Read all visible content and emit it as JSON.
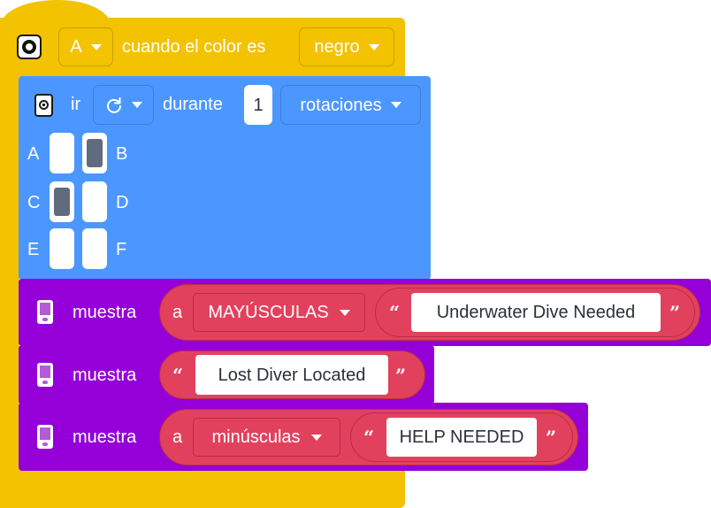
{
  "hat": {
    "port": "A",
    "label": "cuando el color es",
    "color": "negro"
  },
  "motor": {
    "verb": "ir",
    "direction_icon": "clockwise-arrow-icon",
    "during": "durante",
    "amount": "1",
    "unit": "rotaciones",
    "ports": [
      {
        "left": "A",
        "right": "B",
        "left_filled": false,
        "right_filled": true
      },
      {
        "left": "C",
        "right": "D",
        "left_filled": true,
        "right_filled": false
      },
      {
        "left": "E",
        "right": "F",
        "left_filled": false,
        "right_filled": false
      }
    ]
  },
  "display_blocks": [
    {
      "label": "muestra",
      "case_prefix": "a",
      "case_option": "MAYÚSCULAS",
      "text": "Underwater Dive Needed"
    },
    {
      "label": "muestra",
      "text": "Lost Diver Located"
    },
    {
      "label": "muestra",
      "case_prefix": "a",
      "case_option": "minúsculas",
      "text": "HELP NEEDED"
    }
  ],
  "quotes": {
    "open": "“",
    "close": "”"
  },
  "colors": {
    "event_yellow": "#f3c200",
    "motor_blue": "#4c97ff",
    "display_purple": "#9500d9",
    "operator_red": "#e2415d"
  }
}
